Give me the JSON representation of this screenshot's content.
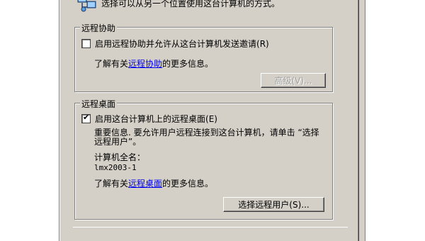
{
  "top": {
    "description": "选择可以从另一个位置使用这台计算机的方式。"
  },
  "remote_assistance": {
    "group_title": "远程协助",
    "checkbox_label": "启用远程协助并允许从这台计算机发送邀请",
    "checkbox_accel": "(R)",
    "checked": false,
    "more_info_prefix": "了解有关",
    "more_info_link": "远程协助",
    "more_info_suffix": "的更多信息。",
    "advanced_button": "高级(V)..."
  },
  "remote_desktop": {
    "group_title": "远程桌面",
    "checkbox_label": "启用这台计算机上的远程桌面",
    "checkbox_accel": "(E)",
    "checked": true,
    "important_line1": "重要信息. 要允许用户远程连接到这台计算机，请单击 “选择",
    "important_line2": "远程用户”。",
    "computer_name_label": "计算机全名：",
    "computer_name_value": "lmx2003-1",
    "more_info_prefix": "了解有关",
    "more_info_link": "远程桌面",
    "more_info_suffix": "的更多信息。",
    "select_users_button": "选择远程用户(S)..."
  },
  "icons": {
    "top_icon": "computers-network-icon",
    "check_mark": "✔"
  }
}
